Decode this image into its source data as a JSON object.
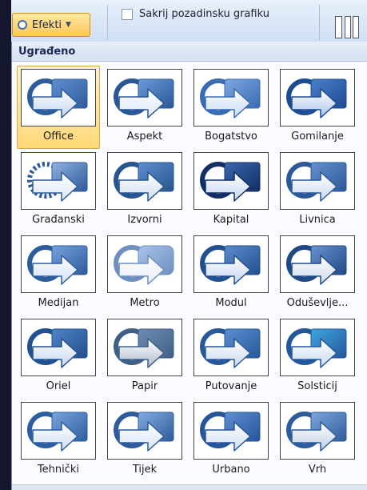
{
  "ribbon": {
    "effects_button_label": "Efekti",
    "hide_background_label": "Sakrij pozadinsku grafiku",
    "hide_background_checked": false
  },
  "gallery": {
    "section_title": "Ugrađeno",
    "selected": "Office",
    "items": [
      {
        "label": "Office",
        "style": "office",
        "colors": [
          "#2f5d9c",
          "#5f8fd0",
          "#c3d4ee"
        ]
      },
      {
        "label": "Aspekt",
        "style": "aspekt",
        "colors": [
          "#2a5796",
          "#6b9bdb",
          "#dbe6f6"
        ]
      },
      {
        "label": "Bogatstvo",
        "style": "bogatstvo",
        "colors": [
          "#3a6bb3",
          "#7ea8e2",
          "#c8d9f1"
        ]
      },
      {
        "label": "Gomilanje",
        "style": "gomilanje",
        "colors": [
          "#1d4c92",
          "#4a7fc8",
          "#a9c4ea"
        ]
      },
      {
        "label": "Građanski",
        "style": "gradjanski",
        "colors": [
          "#2c5a9a",
          "#8fb1de",
          "#dce6f4"
        ]
      },
      {
        "label": "Izvorni",
        "style": "izvorni",
        "colors": [
          "#27558f",
          "#5f8fd0",
          "#d0ddf0"
        ]
      },
      {
        "label": "Kapital",
        "style": "kapital",
        "colors": [
          "#122e66",
          "#3a68ad",
          "#c5d6ee"
        ]
      },
      {
        "label": "Livnica",
        "style": "livnica",
        "colors": [
          "#2b599a",
          "#6690cd",
          "#cad8ee"
        ]
      },
      {
        "label": "Medijan",
        "style": "medijan",
        "colors": [
          "#2d5c9b",
          "#78a2dc",
          "#d3e0f3"
        ]
      },
      {
        "label": "Metro",
        "style": "metro",
        "colors": [
          "#6e8fc0",
          "#a9c3ea",
          "#e7eef9"
        ]
      },
      {
        "label": "Modul",
        "style": "modul",
        "colors": [
          "#22508f",
          "#5d8ccc",
          "#c6d6ee"
        ]
      },
      {
        "label": "Oduševlje...",
        "style": "odusevljenje",
        "colors": [
          "#1f4985",
          "#6a93cf",
          "#cdd9ec"
        ]
      },
      {
        "label": "Oriel",
        "style": "oriel",
        "colors": [
          "#23508e",
          "#4f83c7",
          "#c3d4ec"
        ]
      },
      {
        "label": "Papir",
        "style": "papir",
        "colors": [
          "#3f5f86",
          "#6f8db3",
          "#aebbd0"
        ]
      },
      {
        "label": "Putovanje",
        "style": "putovanje",
        "colors": [
          "#28589a",
          "#5c8fd2",
          "#c8d8ef"
        ]
      },
      {
        "label": "Solsticij",
        "style": "solsticij",
        "colors": [
          "#24579a",
          "#3ea6e0",
          "#c7dcf0"
        ]
      },
      {
        "label": "Tehnički",
        "style": "tehnicki",
        "colors": [
          "#2c5ea0",
          "#7aa4dc",
          "#cfddf2"
        ]
      },
      {
        "label": "Tijek",
        "style": "tijek",
        "colors": [
          "#2d5b9b",
          "#84abe0",
          "#d7e3f5"
        ]
      },
      {
        "label": "Urbano",
        "style": "urbano",
        "colors": [
          "#26559a",
          "#5f90d2",
          "#cddcf1"
        ]
      },
      {
        "label": "Vrh",
        "style": "vrh",
        "colors": [
          "#2d5c9c",
          "#80a6da",
          "#bfcde3"
        ]
      }
    ]
  }
}
